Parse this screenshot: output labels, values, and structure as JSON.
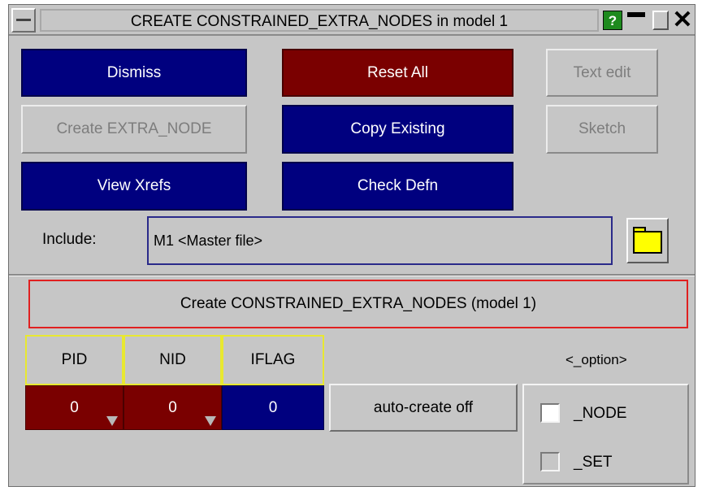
{
  "window": {
    "title": "CREATE CONSTRAINED_EXTRA_NODES in model 1",
    "help_label": "?",
    "close_label": "✕"
  },
  "buttons": {
    "dismiss": "Dismiss",
    "reset_all": "Reset All",
    "text_edit": "Text edit",
    "create_extra_node": "Create EXTRA_NODE",
    "copy_existing": "Copy Existing",
    "sketch": "Sketch",
    "view_xrefs": "View Xrefs",
    "check_defn": "Check Defn"
  },
  "include": {
    "label": "Include:",
    "value": "M1  <Master file>"
  },
  "create_banner": "Create CONSTRAINED_EXTRA_NODES (model 1)",
  "fields": {
    "headers": [
      "PID",
      "NID",
      "IFLAG"
    ],
    "values": [
      "0",
      "0",
      "0"
    ]
  },
  "auto_create": "auto-create off",
  "option": {
    "label": "<_option>",
    "items": [
      {
        "label": "_NODE",
        "checked": true
      },
      {
        "label": "_SET",
        "checked": false
      }
    ]
  },
  "colors": {
    "blue_button": "#00007f",
    "red_button": "#7a0000",
    "panel": "#c6c6c6",
    "banner_border": "#e02020",
    "header_border": "#e8e830",
    "folder": "#ffff00",
    "help_green": "#1e8a1e"
  }
}
